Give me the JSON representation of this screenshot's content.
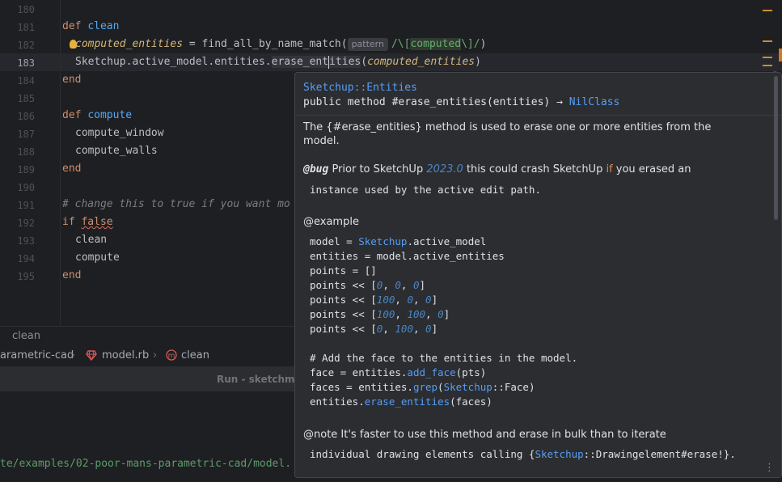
{
  "editor": {
    "lines": [
      {
        "n": "180"
      },
      {
        "n": "181"
      },
      {
        "n": "182"
      },
      {
        "n": "183"
      },
      {
        "n": "184"
      },
      {
        "n": "185"
      },
      {
        "n": "186"
      },
      {
        "n": "187"
      },
      {
        "n": "188"
      },
      {
        "n": "189"
      },
      {
        "n": "190"
      },
      {
        "n": "191"
      },
      {
        "n": "192"
      },
      {
        "n": "193"
      },
      {
        "n": "194"
      },
      {
        "n": "195"
      }
    ],
    "code": {
      "l181_kw": "def",
      "l181_fn": "clean",
      "l182_var": "computed_entities",
      "l182_eq": " = find_all_by_name_match(",
      "l182_hint": "pattern",
      "l182_rx1": "/\\[",
      "l182_rx2": "computed",
      "l182_rx3": "\\]",
      "l182_rx4": "/",
      "l182_end": ")",
      "l183_a": "Sketchup.active_model.entities.",
      "l183_b": "erase_ent",
      "l183_c": "ities",
      "l183_paren": "(",
      "l183_var": "computed_entities",
      "l183_close": ")",
      "l184": "end",
      "l186_kw": "def",
      "l186_fn": "compute",
      "l187": "compute_window",
      "l188": "compute_walls",
      "l189": "end",
      "l191": "# change this to true if you want mo",
      "l192_kw": "if",
      "l192_val": "false",
      "l193": "clean",
      "l194": "compute",
      "l195": "end"
    }
  },
  "status": {
    "context": "clean"
  },
  "breadcrumb": {
    "project": "arametric-cad",
    "file": "model.rb",
    "method": "clean"
  },
  "run": {
    "title": "Run - sketchma",
    "output_path": "te/examples/02-poor-mans-parametric-cad/model."
  },
  "popup": {
    "class_link": "Sketchup::Entities",
    "signature": "public method #erase_entities(entities) → ",
    "return_type": "NilClass",
    "desc1": "The {#erase_entities} method is used to erase one or more entities from the",
    "desc2": "model.",
    "bug_tag": "@bug",
    "bug_a": " Prior to SketchUp ",
    "bug_ver": "2023.0",
    "bug_b": " this could crash SketchUp ",
    "bug_if": "if",
    "bug_c": " you erased an",
    "bug2": "instance used by the active edit path.",
    "example_tag": "@example",
    "ex1_a": "model = ",
    "ex1_cls": "Sketchup",
    "ex1_b": ".active_model",
    "ex2": "entities = model.active_entities",
    "ex3": "points = []",
    "ex4": [
      "points << [",
      "0",
      ", ",
      "0",
      ", ",
      "0",
      "]"
    ],
    "ex5": [
      "points << [",
      "100",
      ", ",
      "0",
      ", ",
      "0",
      "]"
    ],
    "ex6": [
      "points << [",
      "100",
      ", ",
      "100",
      ", ",
      "0",
      "]"
    ],
    "ex7": [
      "points << [",
      "0",
      ", ",
      "100",
      ", ",
      "0",
      "]"
    ],
    "ex9": "# Add the face to the entities in the model.",
    "ex10_a": "face = entities.",
    "ex10_m": "add_face",
    "ex10_b": "(pts)",
    "ex11_a": "faces = entities.",
    "ex11_m": "grep",
    "ex11_b": "(",
    "ex11_cls": "Sketchup",
    "ex11_c": "::Face)",
    "ex12_a": "entities.",
    "ex12_m": "erase_entities",
    "ex12_b": "(faces)",
    "note_a": "@note It's faster to use this method and erase in bulk than to iterate",
    "note2_a": "individual drawing elements calling {",
    "note2_cls": "Sketchup",
    "note2_b": "::Drawingelement#erase!}.",
    "more": "⋮"
  }
}
